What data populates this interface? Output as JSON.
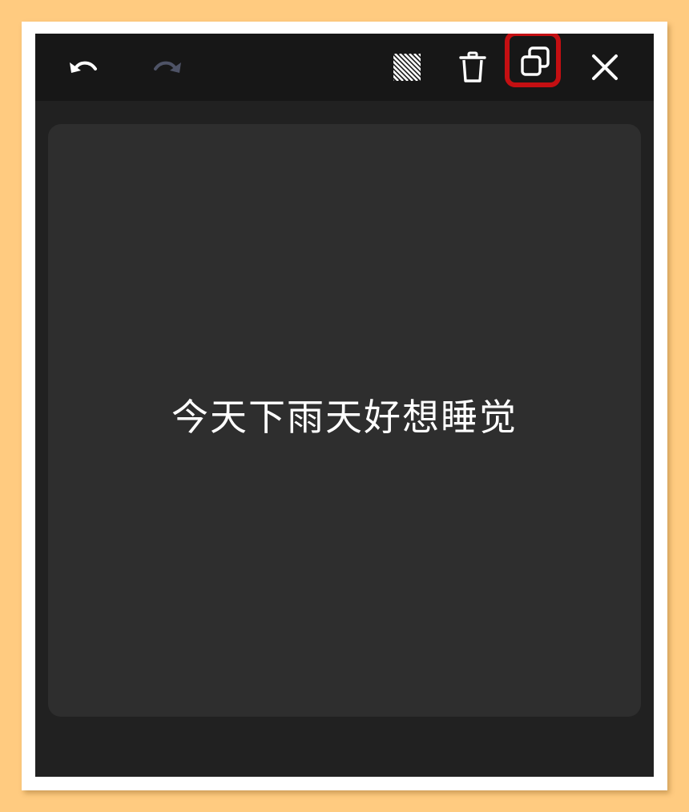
{
  "toolbar": {
    "undo": {
      "icon": "undo-icon",
      "enabled": true
    },
    "redo": {
      "icon": "redo-icon",
      "enabled": false
    },
    "pattern": {
      "icon": "hatch-pattern-icon"
    },
    "delete": {
      "icon": "trash-icon"
    },
    "duplicate": {
      "icon": "duplicate-icon",
      "highlighted": true
    },
    "close": {
      "icon": "close-icon"
    }
  },
  "canvas": {
    "text": "今天下雨天好想睡觉"
  },
  "colors": {
    "page_background": "#FFCB80",
    "frame": "#FFFFFF",
    "app_background": "#212121",
    "toolbar_background": "#171717",
    "canvas_background": "#2E2E2E",
    "icon_active": "#FFFFFF",
    "icon_disabled": "#4E5366",
    "highlight": "#C40F12",
    "text": "#FFFFFF"
  }
}
